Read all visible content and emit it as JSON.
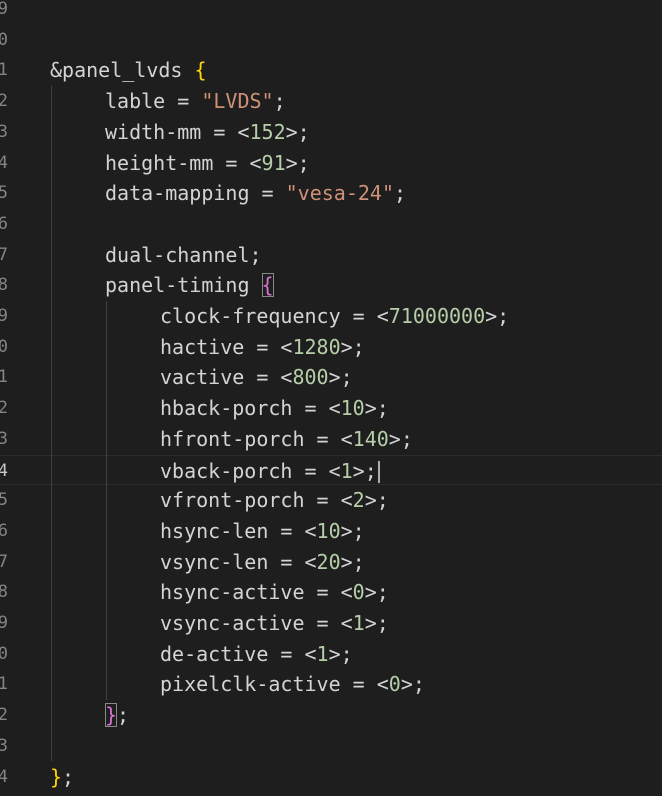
{
  "editor": {
    "lines": [
      {
        "no": "9",
        "tokens": []
      },
      {
        "no": "0",
        "tokens": []
      },
      {
        "no": "1",
        "indent": 0,
        "tokens": [
          {
            "t": "&panel_lvds ",
            "c": "t-key"
          },
          {
            "t": "{",
            "c": "t-brace1"
          }
        ]
      },
      {
        "no": "2",
        "indent": 1,
        "tokens": [
          {
            "t": "lable = ",
            "c": "t-key"
          },
          {
            "t": "\"LVDS\"",
            "c": "t-str"
          },
          {
            "t": ";",
            "c": "t-punct"
          }
        ]
      },
      {
        "no": "3",
        "indent": 1,
        "tokens": [
          {
            "t": "width-mm = <",
            "c": "t-key"
          },
          {
            "t": "152",
            "c": "t-num"
          },
          {
            "t": ">;",
            "c": "t-punct"
          }
        ]
      },
      {
        "no": "4",
        "indent": 1,
        "tokens": [
          {
            "t": "height-mm = <",
            "c": "t-key"
          },
          {
            "t": "91",
            "c": "t-num"
          },
          {
            "t": ">;",
            "c": "t-punct"
          }
        ]
      },
      {
        "no": "5",
        "indent": 1,
        "tokens": [
          {
            "t": "data-mapping = ",
            "c": "t-key"
          },
          {
            "t": "\"vesa-24\"",
            "c": "t-str"
          },
          {
            "t": ";",
            "c": "t-punct"
          }
        ]
      },
      {
        "no": "6",
        "tokens": []
      },
      {
        "no": "7",
        "indent": 1,
        "tokens": [
          {
            "t": "dual-channel;",
            "c": "t-key"
          }
        ]
      },
      {
        "no": "8",
        "indent": 1,
        "tokens": [
          {
            "t": "panel-timing ",
            "c": "t-key"
          },
          {
            "t": "{",
            "c": "t-brace2",
            "match": true
          }
        ]
      },
      {
        "no": "9",
        "indent": 2,
        "tokens": [
          {
            "t": "clock-frequency = <",
            "c": "t-key"
          },
          {
            "t": "71000000",
            "c": "t-num"
          },
          {
            "t": ">;",
            "c": "t-punct"
          }
        ]
      },
      {
        "no": "0",
        "indent": 2,
        "tokens": [
          {
            "t": "hactive = <",
            "c": "t-key"
          },
          {
            "t": "1280",
            "c": "t-num"
          },
          {
            "t": ">;",
            "c": "t-punct"
          }
        ]
      },
      {
        "no": "1",
        "indent": 2,
        "tokens": [
          {
            "t": "vactive = <",
            "c": "t-key"
          },
          {
            "t": "800",
            "c": "t-num"
          },
          {
            "t": ">;",
            "c": "t-punct"
          }
        ]
      },
      {
        "no": "2",
        "indent": 2,
        "tokens": [
          {
            "t": "hback-porch = <",
            "c": "t-key"
          },
          {
            "t": "10",
            "c": "t-num"
          },
          {
            "t": ">;",
            "c": "t-punct"
          }
        ]
      },
      {
        "no": "3",
        "indent": 2,
        "tokens": [
          {
            "t": "hfront-porch = <",
            "c": "t-key"
          },
          {
            "t": "140",
            "c": "t-num"
          },
          {
            "t": ">;",
            "c": "t-punct"
          }
        ]
      },
      {
        "no": "4",
        "indent": 2,
        "current": true,
        "tokens": [
          {
            "t": "vback-porch = <",
            "c": "t-key"
          },
          {
            "t": "1",
            "c": "t-num"
          },
          {
            "t": ">;",
            "c": "t-punct"
          }
        ]
      },
      {
        "no": "5",
        "indent": 2,
        "tokens": [
          {
            "t": "vfront-porch = <",
            "c": "t-key"
          },
          {
            "t": "2",
            "c": "t-num"
          },
          {
            "t": ">;",
            "c": "t-punct"
          }
        ]
      },
      {
        "no": "6",
        "indent": 2,
        "tokens": [
          {
            "t": "hsync-len = <",
            "c": "t-key"
          },
          {
            "t": "10",
            "c": "t-num"
          },
          {
            "t": ">;",
            "c": "t-punct"
          }
        ]
      },
      {
        "no": "7",
        "indent": 2,
        "tokens": [
          {
            "t": "vsync-len = <",
            "c": "t-key"
          },
          {
            "t": "20",
            "c": "t-num"
          },
          {
            "t": ">;",
            "c": "t-punct"
          }
        ]
      },
      {
        "no": "8",
        "indent": 2,
        "tokens": [
          {
            "t": "hsync-active = <",
            "c": "t-key"
          },
          {
            "t": "0",
            "c": "t-num"
          },
          {
            "t": ">;",
            "c": "t-punct"
          }
        ]
      },
      {
        "no": "9",
        "indent": 2,
        "tokens": [
          {
            "t": "vsync-active = <",
            "c": "t-key"
          },
          {
            "t": "1",
            "c": "t-num"
          },
          {
            "t": ">;",
            "c": "t-punct"
          }
        ]
      },
      {
        "no": "0",
        "indent": 2,
        "tokens": [
          {
            "t": "de-active = <",
            "c": "t-key"
          },
          {
            "t": "1",
            "c": "t-num"
          },
          {
            "t": ">;",
            "c": "t-punct"
          }
        ]
      },
      {
        "no": "1",
        "indent": 2,
        "tokens": [
          {
            "t": "pixelclk-active = <",
            "c": "t-key"
          },
          {
            "t": "0",
            "c": "t-num"
          },
          {
            "t": ">;",
            "c": "t-punct"
          }
        ]
      },
      {
        "no": "2",
        "indent": 1,
        "tokens": [
          {
            "t": "}",
            "c": "t-brace2",
            "match": true
          },
          {
            "t": ";",
            "c": "t-punct"
          }
        ]
      },
      {
        "no": "3",
        "tokens": []
      },
      {
        "no": "4",
        "indent": 0,
        "tokens": [
          {
            "t": "}",
            "c": "t-brace1"
          },
          {
            "t": ";",
            "c": "t-punct"
          }
        ]
      }
    ]
  },
  "colors": {
    "background": "#1e1e1e",
    "string": "#ce9178",
    "number": "#b5cea8",
    "brace_level1": "#ffd700",
    "brace_level2": "#da70d6"
  }
}
